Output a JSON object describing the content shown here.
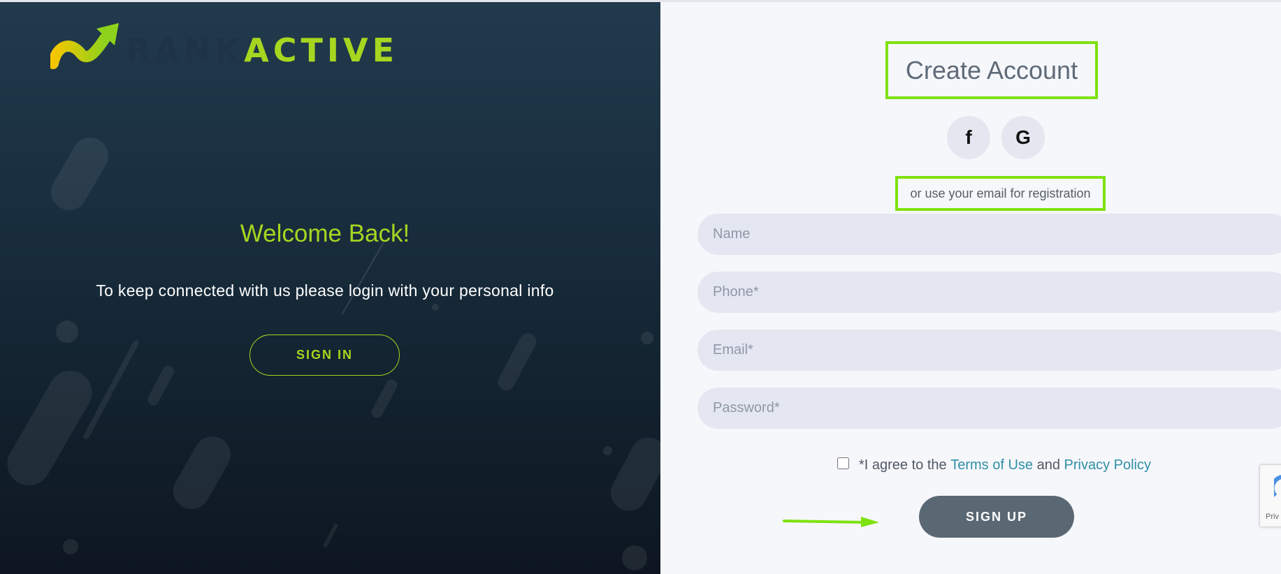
{
  "brand": {
    "logo_rank": "RANK",
    "logo_active": "ACTIVE"
  },
  "left": {
    "welcome": "Welcome Back!",
    "message": "To keep connected with us please login with your personal info",
    "signin_label": "SIGN IN"
  },
  "right": {
    "title": "Create Account",
    "facebook_glyph": "f",
    "google_glyph": "G",
    "subtitle": "or use your email for registration",
    "fields": {
      "name_placeholder": "Name",
      "phone_placeholder": "Phone*",
      "email_placeholder": "Email*",
      "password_placeholder": "Password*"
    },
    "agree": {
      "prefix": "*I agree to the",
      "terms": "Terms of Use",
      "and": "and",
      "privacy": "Privacy Policy"
    },
    "signup_label": "SIGN UP",
    "recaptcha_text": "Priv"
  },
  "colors": {
    "accent": "#a6d620",
    "highlight": "#7ee20f",
    "link": "#2f8fa6",
    "signup_button": "#5a6873",
    "dark_panel": "#172b3a"
  }
}
